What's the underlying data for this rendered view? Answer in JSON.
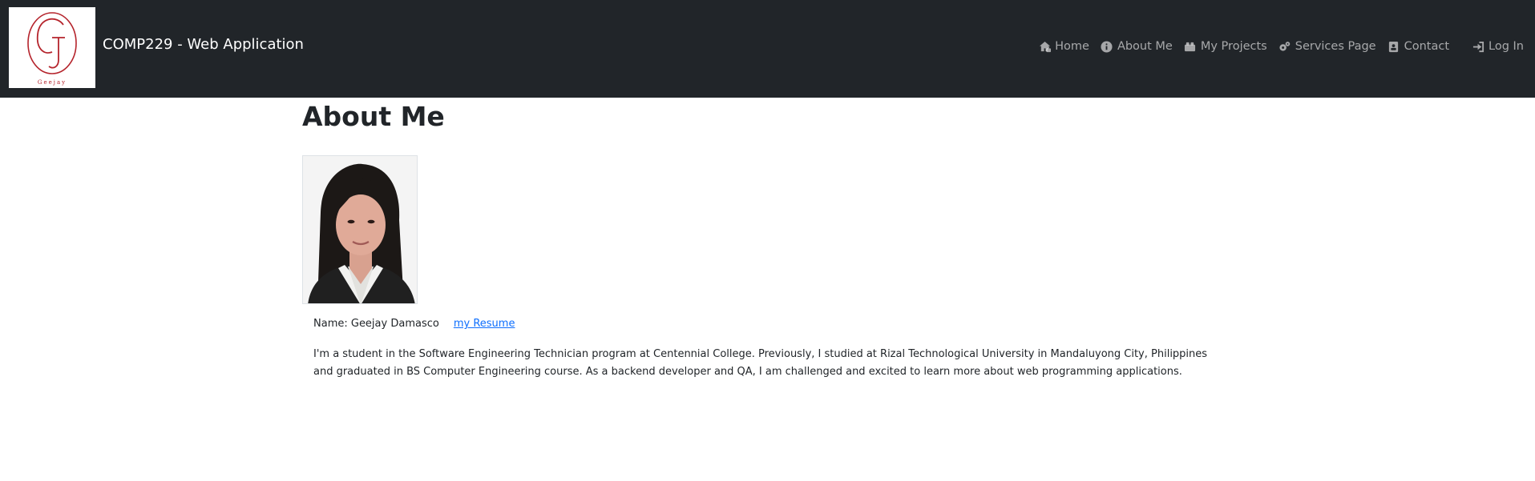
{
  "header": {
    "brand": "COMP229 - Web Application",
    "logo_text": "Geejay",
    "nav": [
      {
        "label": "Home",
        "icon": "home-icon"
      },
      {
        "label": "About Me",
        "icon": "info-icon"
      },
      {
        "label": "My Projects",
        "icon": "projects-icon"
      },
      {
        "label": "Services Page",
        "icon": "gears-icon"
      },
      {
        "label": "Contact",
        "icon": "contact-icon"
      },
      {
        "label": "Log In",
        "icon": "login-icon"
      }
    ]
  },
  "main": {
    "title": "About Me",
    "name_label": "Name: Geejay Damasco",
    "resume_link": "my Resume",
    "bio": "I'm a student in the Software Engineering Technician program at Centennial College. Previously, I studied at Rizal Technological University in Mandaluyong City, Philippines and graduated in BS Computer Engineering course. As a backend developer and QA, I am challenged and excited to learn more about web programming applications."
  },
  "colors": {
    "navbar_bg": "#212529",
    "link": "#0d6efd",
    "logo_accent": "#b5242c"
  }
}
